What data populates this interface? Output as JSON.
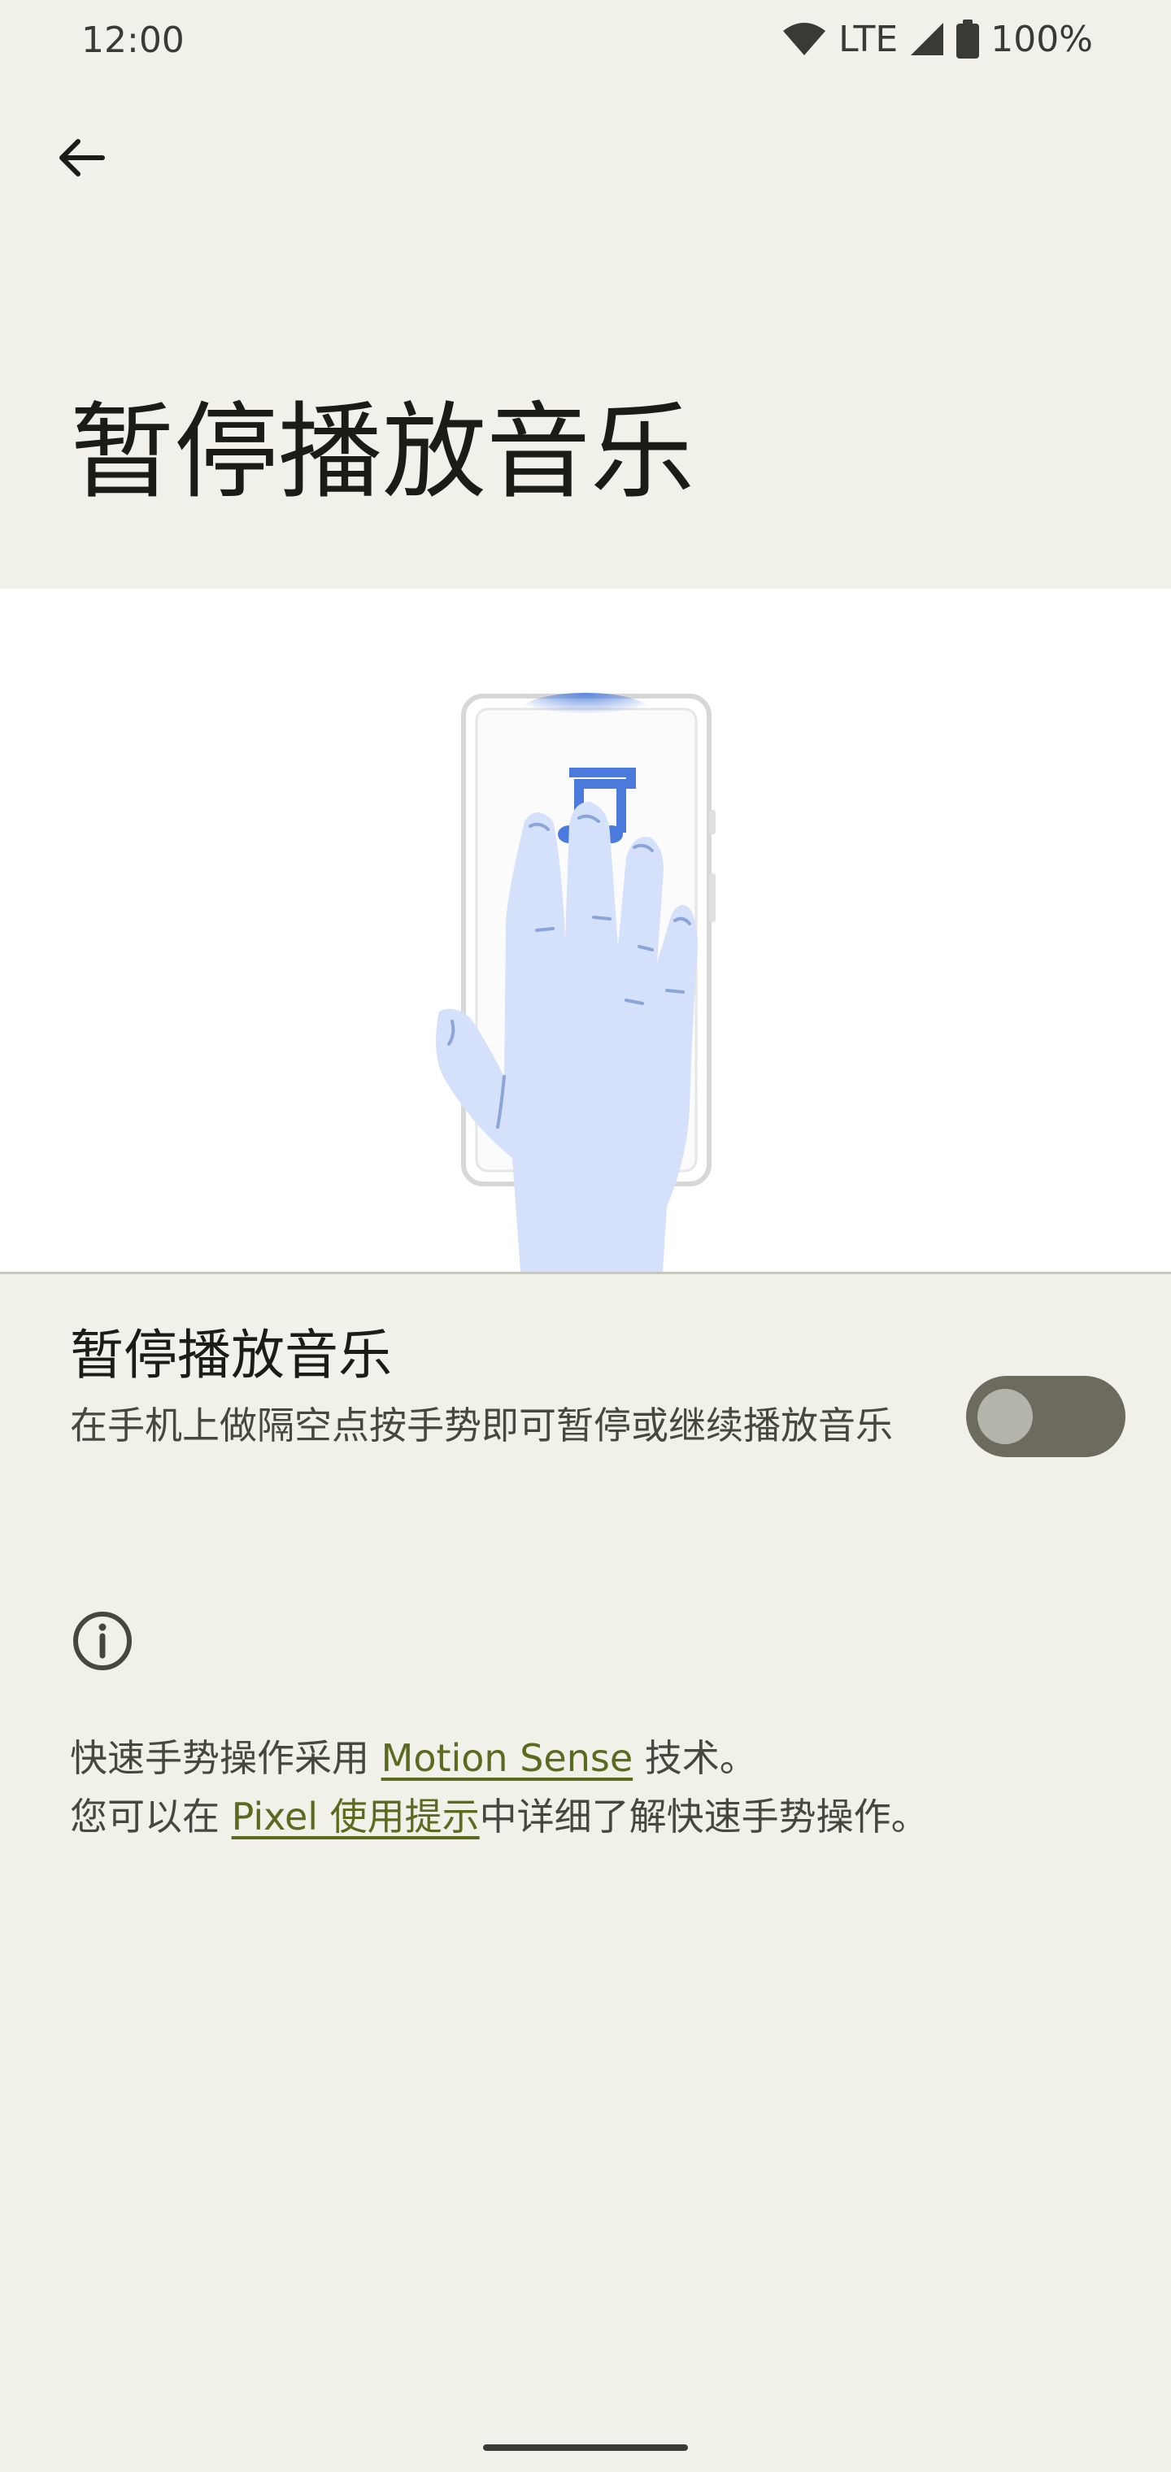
{
  "status_bar": {
    "time": "12:00",
    "network": "LTE",
    "battery": "100%"
  },
  "icons": {
    "back": "arrow-back-icon",
    "info": "info-icon",
    "wifi": "wifi-icon",
    "signal": "cell-signal-icon",
    "battery": "battery-icon"
  },
  "page": {
    "title": "暂停播放音乐"
  },
  "setting": {
    "title": "暂停播放音乐",
    "summary": "在手机上做隔空点按手势即可暂停或继续播放音乐",
    "enabled": false
  },
  "footer": {
    "line1_prefix": "快速手势操作采用 ",
    "line1_link": "Motion Sense",
    "line1_suffix": " 技术。",
    "line2_prefix": "您可以在 ",
    "line2_link": "Pixel 使用提示",
    "line2_suffix": "中详细了解快速手势操作。"
  },
  "colors": {
    "background": "#f1f0e9",
    "toggle_track_off": "#6c6b5e",
    "link": "#5b6a1f",
    "illustration_blue": "#4a7bdc",
    "hand_fill": "#d5e1fa"
  }
}
